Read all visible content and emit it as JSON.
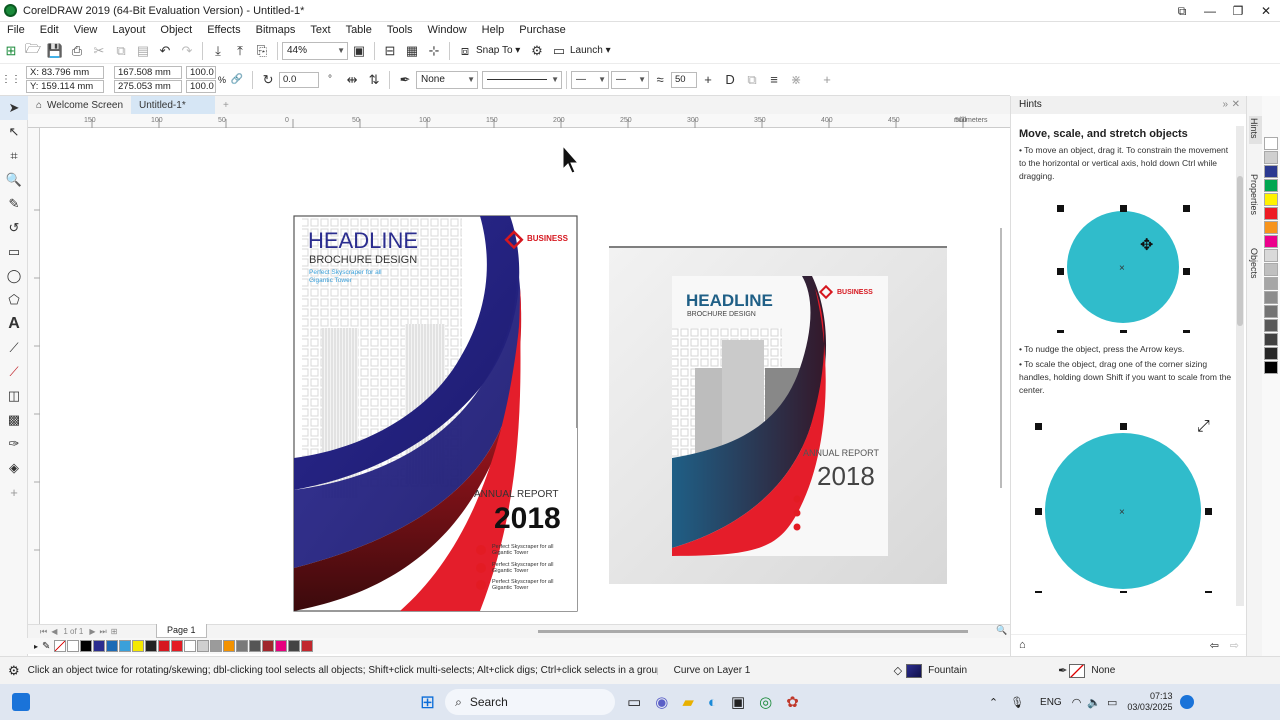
{
  "window": {
    "title": "CorelDRAW 2019 (64-Bit Evaluation Version) - Untitled-1*"
  },
  "menu": [
    "File",
    "Edit",
    "View",
    "Layout",
    "Object",
    "Effects",
    "Bitmaps",
    "Text",
    "Table",
    "Tools",
    "Window",
    "Help",
    "Purchase"
  ],
  "toolbar": {
    "zoom": "44%",
    "snap": "Snap To",
    "launch": "Launch"
  },
  "propbar": {
    "x": "X: 83.796 mm",
    "y": "Y: 159.114 mm",
    "w": "167.508 mm",
    "h": "275.053 mm",
    "sx": "100.0",
    "sy": "100.0",
    "pct": "%",
    "angle": "0.0",
    "outline": "None",
    "num": "50"
  },
  "tabs": {
    "welcome": "Welcome Screen",
    "doc": "Untitled-1*"
  },
  "ruler": {
    "ticks": [
      "150",
      "100",
      "50",
      "0",
      "50",
      "100",
      "150",
      "200",
      "250",
      "300",
      "350",
      "400",
      "450",
      "500"
    ],
    "unit": "millimeters"
  },
  "brochure1": {
    "headline": "HEADLINE",
    "sub": "BROCHURE DESIGN",
    "tag1": "Perfect Skyscraper for all",
    "tag2": "Gigantic Tower",
    "business": "BUSINESS",
    "annual": "ANNUAL REPORT",
    "year": "2018",
    "b1a": "Perfect Skyscraper for all",
    "b1b": "Gigantic Tower",
    "b2a": "Perfect Skyscraper for all",
    "b2b": "Gigantic Tower",
    "b3a": "Perfect Skyscraper for all",
    "b3b": "Gigantic Tower"
  },
  "brochure2": {
    "headline": "HEADLINE",
    "sub": "BROCHURE DESIGN",
    "business": "BUSINESS",
    "annual": "ANNUAL REPORT",
    "year": "2018"
  },
  "pagenav": {
    "count": "1 of 1",
    "page": "Page 1"
  },
  "hints": {
    "panel": "Hints",
    "title": "Move, scale, and stretch objects",
    "p1": "• To move an object, drag it. To constrain the movement to the horizontal or vertical axis, hold down Ctrl while dragging.",
    "p2": "• To nudge the object, press the Arrow keys.",
    "p3": "• To scale the object, drag one of the corner sizing handles, holding down Shift if you want to scale from the center.",
    "circle_color": "#30bccb"
  },
  "righttabs": {
    "hints": "Hints",
    "properties": "Properties",
    "objects": "Objects"
  },
  "status": {
    "msg": "Click an object twice for rotating/skewing; dbl-clicking tool selects all objects; Shift+click multi-selects; Alt+click digs; Ctrl+click selects in a group",
    "layer": "Curve on Layer 1",
    "fill": "Fountain",
    "outline": "None"
  },
  "taskbar": {
    "search": "Search",
    "lang": "ENG",
    "time": "07:13",
    "date": "03/03/2025"
  },
  "palette": [
    "#ffffff",
    "#000000",
    "#2b2d8f",
    "#1c6ab5",
    "#3aa0da",
    "#f5e800",
    "#222222",
    "#d6171f",
    "#e31b23",
    "#ffffff",
    "#cfcfcf",
    "#9b9b9b",
    "#f39200",
    "#7a7a7a",
    "#555555",
    "#a0262c",
    "#e6007e",
    "#444444",
    "#c1272d"
  ],
  "rpalette": [
    "#ffffff",
    "#cfcfcf",
    "#2b3990",
    "#00a651",
    "#fff200",
    "#ed1c24",
    "#f7941d",
    "#ec008c",
    "#d9d9d9",
    "#bfbfbf",
    "#a6a6a6",
    "#8c8c8c",
    "#737373",
    "#595959",
    "#404040",
    "#262626",
    "#000000"
  ]
}
